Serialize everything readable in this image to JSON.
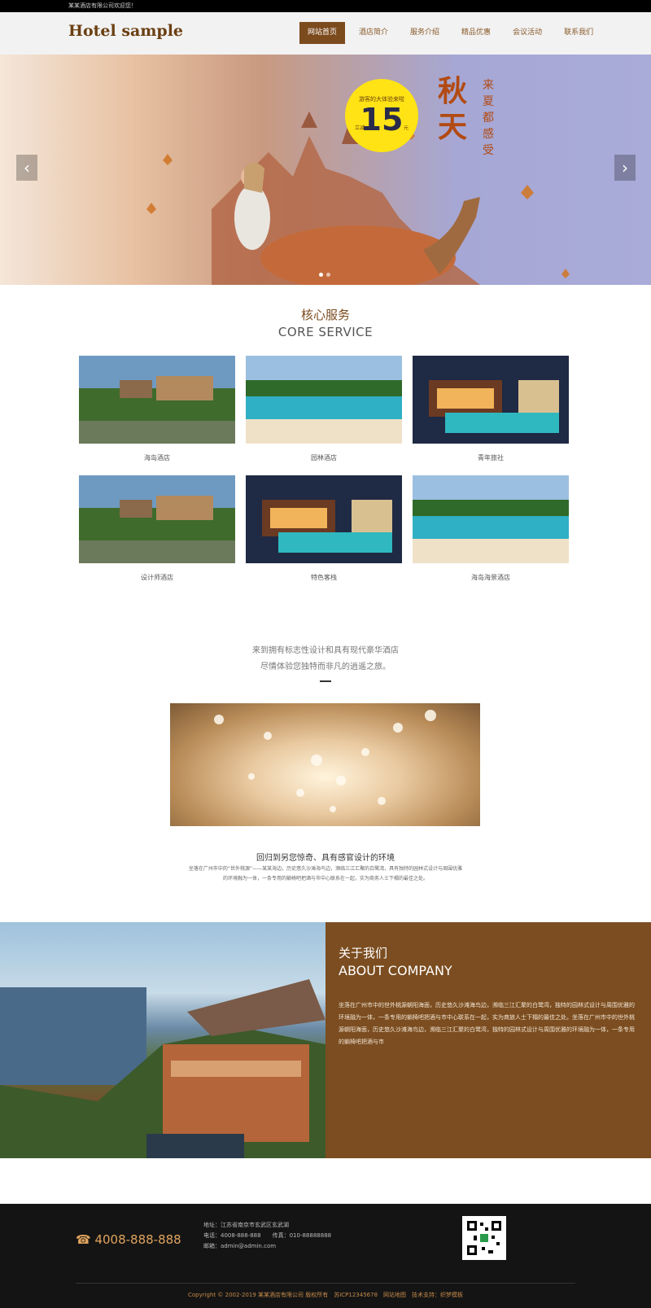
{
  "topbar": {
    "text": "某某酒店有限公司欢迎您！"
  },
  "header": {
    "logo": "Hotel sample"
  },
  "nav": [
    {
      "label": "网站首页",
      "active": true
    },
    {
      "label": "酒店简介",
      "active": false
    },
    {
      "label": "服务介绍",
      "active": false
    },
    {
      "label": "精品优惠",
      "active": false
    },
    {
      "label": "会议活动",
      "active": false
    },
    {
      "label": "联系我们",
      "active": false
    }
  ],
  "banner": {
    "promo_line": "游客的大体验来啦",
    "promo_number": "15",
    "promo_left": "立减",
    "promo_right": "元",
    "big_text": "秋天",
    "sub_text": "来夏都感受",
    "prev": "‹",
    "next": "›"
  },
  "core": {
    "title_cn": "核心服务",
    "title_en": "CORE SERVICE",
    "items": [
      {
        "caption": "海岛酒店",
        "scene": "village"
      },
      {
        "caption": "园林酒店",
        "scene": "beach"
      },
      {
        "caption": "青年旅社",
        "scene": "pool"
      },
      {
        "caption": "设计师酒店",
        "scene": "village"
      },
      {
        "caption": "特色客栈",
        "scene": "pool"
      },
      {
        "caption": "海岛海景酒店",
        "scene": "beach"
      }
    ]
  },
  "intro": {
    "line1": "来到拥有标志性设计和具有现代豪华酒店",
    "line2": "尽情体验您独特而非凡的逍遥之旅。"
  },
  "environment": {
    "title": "回归到另您惊奇、具有感官设计的环境",
    "text": "坐落在广州市中的“世外桃源”——某某海边，历史悠久沙滩海鸟边，濒临三江汇聚的白鹭湾，具有独特的园林式设计与周围优雅的环境融为一体，一条专用的躺椅吧把酒与市中心联系在一起，实为商务人士下榻的最佳之处。"
  },
  "about": {
    "title_cn": "关于我们",
    "title_en": "ABOUT COMPANY",
    "text": "坐落在广州市中的世外桃源朝阳海面，历史悠久沙滩海鸟边，濒临三江汇聚的白鹭湾，独特的园林式设计与周围优雅的环境融为一体，一条专用的躺椅吧把酒与市中心联系在一起，实为商旅人士下榻的最佳之处。坐落在广州市中的世外桃源朝阳海面，历史悠久沙滩海鸟边，濒临三江汇聚的白鹭湾，独特的园林式设计与周围优雅的环境融为一体，一条专用的躺椅吧把酒与市"
  },
  "footer": {
    "phone": "4008-888-888",
    "address": "地址：江苏省南京市玄武区玄武湖",
    "tel": "电话：4008-888-888　　传真：010-88888888",
    "email": "邮箱：admin@admin.com",
    "copyright": "Copyright © 2002-2019 某某酒店有限公司 版权所有　苏ICP12345678　网站地图　技术支持：织梦模板"
  }
}
